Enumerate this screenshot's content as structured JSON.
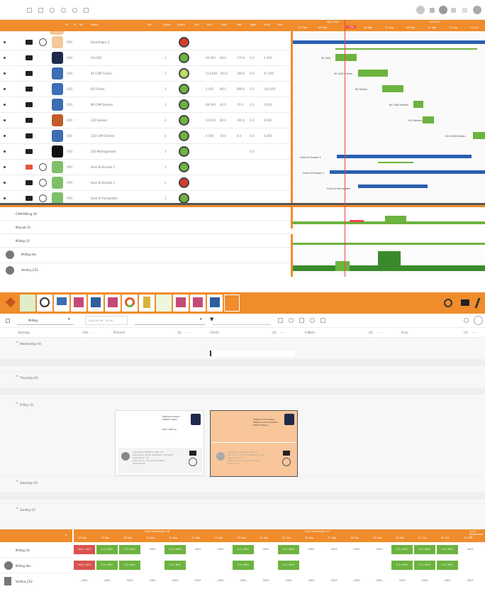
{
  "top": {
    "timeline": {
      "month_top": "May 2024",
      "month_top2": "Oct 2024",
      "today": "1 Mar",
      "dates": [
        "03 Sep",
        "06 Sep",
        "1 Mar",
        "20 Sep",
        "27 Sep",
        "08 Sep",
        "15 Sep",
        "23 Sep",
        "07 Oct"
      ]
    },
    "headers": [
      "ID",
      "N",
      "Sel",
      "Name",
      "Pos",
      "Dauer",
      "Status",
      "S/W",
      "RGC",
      "SSW",
      "MW",
      "Tagm",
      "Ende",
      "Prio"
    ],
    "rows": [
      {
        "tag": "(PR)",
        "name": "Hydrofeger_1",
        "mail": "dark",
        "status": "red"
      },
      {
        "tag": "(SR)",
        "name": "20 CAD",
        "num": "3",
        "vals": [
          "90.000",
          "88.0",
          "179.0",
          "0.0",
          "0.000"
        ],
        "mail": "dark",
        "status": "green"
      },
      {
        "tag": "(SR)",
        "name": "40 CAM Fräsen",
        "num": "3",
        "vals": [
          "114.800",
          "160.0",
          "288.0",
          "0.0",
          "47.000"
        ],
        "mail": "dark",
        "status": "lime"
      },
      {
        "tag": "(SR)",
        "name": "60 Fräsen",
        "num": "3",
        "vals": [
          "0.000",
          "88.0",
          "888.0",
          "0.0",
          "140.000"
        ],
        "mail": "dark",
        "status": "green"
      },
      {
        "tag": "(SR)",
        "name": "80 CAM Senken",
        "num": "3",
        "vals": [
          "88.000",
          "40.0",
          "70.0",
          "0.0",
          "0.000"
        ],
        "mail": "dark",
        "status": "green"
      },
      {
        "tag": "(SR)",
        "name": "120 Senken",
        "num": "3",
        "vals": [
          "52.000",
          "88.0",
          "180.0",
          "0.0",
          "8.000"
        ],
        "mail": "dark",
        "status": "green"
      },
      {
        "tag": "(SR)",
        "name": "120 CAM Drehen",
        "num": "3",
        "vals": [
          "4.000",
          "19.0",
          "8.0",
          "0.0",
          "4.000"
        ],
        "mail": "dark",
        "status": "green"
      },
      {
        "tag": "(SR)",
        "name": "200 Montagestart",
        "num": "3",
        "vals": [
          "",
          "",
          "",
          "0.0",
          ""
        ],
        "mail": "dark",
        "status": "green"
      },
      {
        "tag": "(PR)",
        "name": "Hum-Kl Einsatz 1",
        "num": "3",
        "vals": [
          "",
          "",
          "",
          "",
          ""
        ],
        "mail": "red",
        "status": "green"
      },
      {
        "tag": "(PR)",
        "name": "Hum-Kl Einsatz 2",
        "num": "2",
        "vals": [
          "",
          "",
          "",
          "",
          ""
        ],
        "mail": "dark",
        "status": "red"
      },
      {
        "tag": "(PR)",
        "name": "Hum-Kl Formplatte",
        "num": "1",
        "vals": [
          "",
          "",
          "",
          "",
          ""
        ],
        "mail": "dark",
        "status": "green"
      }
    ],
    "gantt_labels": [
      "20 CAD",
      "40 CAM Fräsen",
      "60 Fräsen",
      "80 CAM Senken",
      "120 Senken",
      "120 CAM Drehen",
      "Hum-Kl Einsatz 1",
      "Hum-Kl Einsatz 2",
      "Hum-Kl Formplatte"
    ],
    "bottom": {
      "rows": [
        "CAM-Milling (6)",
        "Manual (1)",
        "Milling (3)",
        "Milling dev",
        "Vertika_C22"
      ]
    }
  },
  "board": {
    "filter": {
      "group": "Milling",
      "date": "2024-09-16 - 04.08",
      "search_placeholder": ""
    },
    "columns": [
      "Backlog",
      "Planned",
      "Clarify",
      "InWork",
      "Error"
    ],
    "column_counts": [
      "(20)",
      "(4)",
      "(4)",
      "(4)",
      "(4)"
    ],
    "days": [
      "Wednesday (0)",
      "Thursday (0)",
      "Friday (3)",
      "Saturday (0)",
      "Sunday (0)"
    ],
    "cards": [
      {
        "title": "[PR]Hydrofeger1\n[SR]60 Fräsen",
        "badge": "[SP] 3 Milling",
        "body": "operations/ Method offer 0:0\nplanned 0: 00:00, Feedback: 00:00:00\nsetup time: 0:0\nplanned no: 16, planned date:\n2024-09-23"
      },
      {
        "title": "[PR]Hum-Kl Einsatz1\n[SR]Hum-Kl Formplatte\n[SP]60 Fräsen",
        "badge": "",
        "body": "operations/ Method offer 0:0\nplanned 0: 00:00, Feedback: 00:00\nsetup time: 0:0\nplanned no: 16, planned date:\n2024-09-25"
      }
    ],
    "capacity": {
      "weeks": [
        "2024 September 16",
        "2024 September 23",
        "2024 September 30"
      ],
      "days": [
        "16 Sep",
        "17 Sep",
        "18 Sep",
        "19 Sep",
        "20 Sep",
        "21 Sep",
        "22 Sep",
        "23 Sep",
        "24 Sep",
        "25 Sep",
        "26 Sep",
        "27 Sep",
        "28 Sep",
        "29 Sep",
        "30 Sep",
        "01 Oct",
        "02 Oct",
        "03 Oct"
      ],
      "rows": [
        "Milling (4)",
        "Milling dev",
        "Vertika_C22"
      ],
      "row1": [
        "16.0 / 16.0",
        "0.0 / 8h5",
        "0.0 / 8h5",
        "16h5",
        "0.0 / 16h5",
        "16h5",
        "16h5",
        "0.0 / 8h5",
        "16h5",
        "0.0 / 8h5",
        "16h5",
        "16h5",
        "16h5",
        "16h5",
        "0.0 / 8h5",
        "0.0 / 8h5",
        "0.0 / 8h5",
        "16h5"
      ],
      "row2": [
        "16.0 / 16.0",
        "0.0 / 8h5",
        "0.0 / 8h5",
        "",
        "0.0 / 8h5",
        "",
        "",
        "0.0 / 8h5",
        "",
        "0.0 / 8h5",
        "",
        "",
        "",
        "",
        "0.0 / 8h5",
        "0.0 / 8h5",
        "0.0 / 8h5",
        ""
      ],
      "row3": [
        "20h5",
        "20h5",
        "20h5",
        "20h5",
        "20h5",
        "20h5",
        "20h5",
        "20h5",
        "20h5",
        "20h5",
        "20h5",
        "20h5",
        "20h5",
        "20h5",
        "20h5",
        "20h5",
        "20h5",
        "20h5"
      ]
    }
  }
}
